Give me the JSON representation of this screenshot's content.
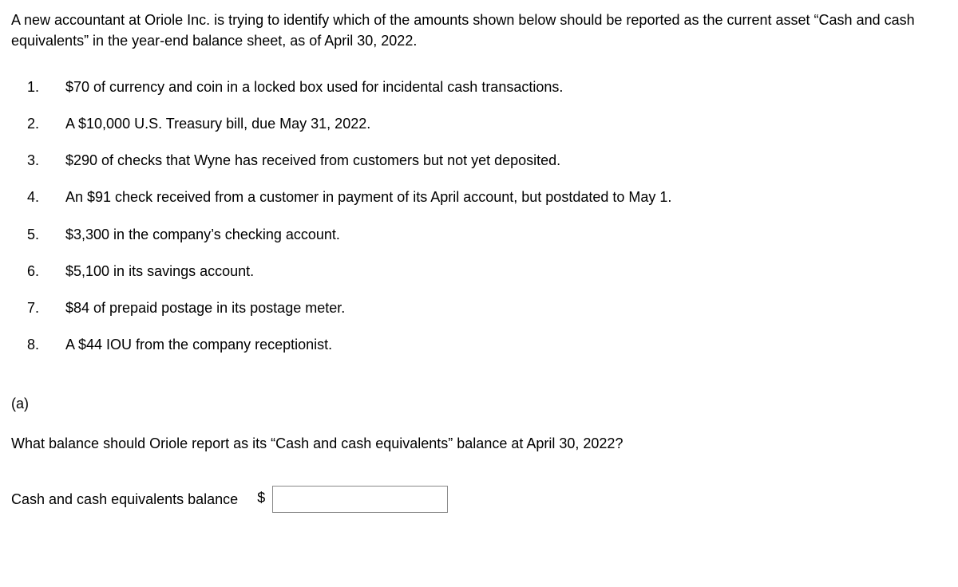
{
  "intro": "A new accountant at Oriole Inc. is trying to identify which of the amounts shown below should be reported as the current asset “Cash and cash equivalents” in the year-end balance sheet, as of April 30, 2022.",
  "items": [
    {
      "num": "1.",
      "text": "$70 of currency and coin in a locked box used for incidental cash transactions."
    },
    {
      "num": "2.",
      "text": "A $10,000 U.S. Treasury bill, due May 31, 2022."
    },
    {
      "num": "3.",
      "text": "$290 of checks that Wyne has received from customers but not yet deposited."
    },
    {
      "num": "4.",
      "text": "An $91 check received from a customer in payment of its April account, but postdated to May 1."
    },
    {
      "num": "5.",
      "text": "$3,300 in the company’s checking account."
    },
    {
      "num": "6.",
      "text": "$5,100 in its savings account."
    },
    {
      "num": "7.",
      "text": "$84 of prepaid postage in its postage meter."
    },
    {
      "num": "8.",
      "text": "A $44 IOU from the company receptionist."
    }
  ],
  "part_label": "(a)",
  "question": "What balance should Oriole report as its “Cash and cash equivalents” balance at April 30, 2022?",
  "answer": {
    "label": "Cash and cash equivalents balance",
    "currency": "$",
    "value": ""
  }
}
